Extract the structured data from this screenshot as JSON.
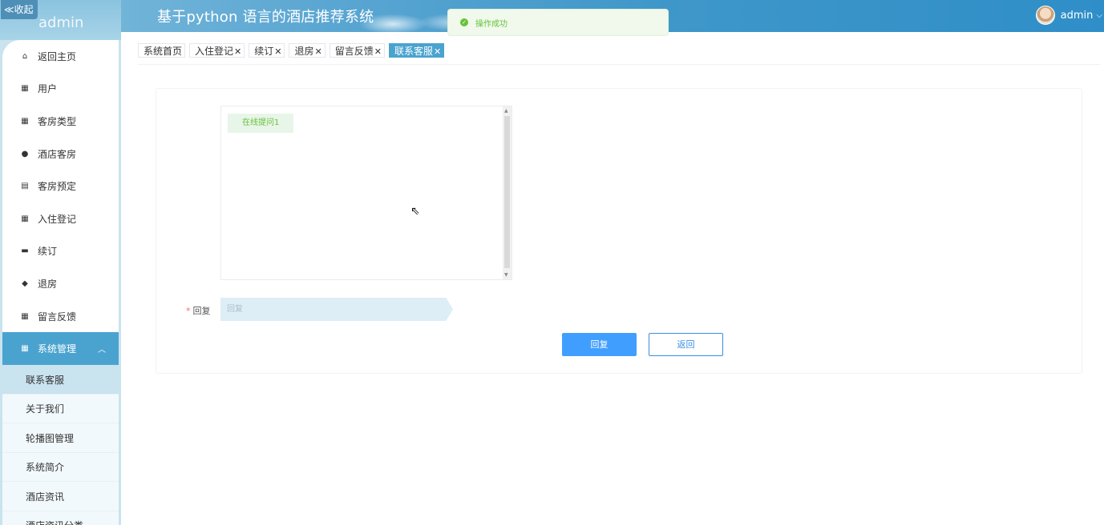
{
  "header": {
    "title": "基于python 语言的酒店推荐系统",
    "collapse_label": "≪收起",
    "user_name": "admin"
  },
  "toast": {
    "text": "操作成功",
    "type": "success"
  },
  "sidebar": {
    "brand_ghost": "admin",
    "items": [
      {
        "label": "返回主页",
        "icon": "home-icon"
      },
      {
        "label": "用户",
        "icon": "grid-icon"
      },
      {
        "label": "客房类型",
        "icon": "grid-icon"
      },
      {
        "label": "酒店客房",
        "icon": "person-icon"
      },
      {
        "label": "客房预定",
        "icon": "clipboard-icon"
      },
      {
        "label": "入住登记",
        "icon": "grid-icon"
      },
      {
        "label": "续订",
        "icon": "briefcase-icon"
      },
      {
        "label": "退房",
        "icon": "pin-icon"
      },
      {
        "label": "留言反馈",
        "icon": "grid-icon"
      }
    ],
    "active_group": {
      "label": "系统管理",
      "icon": "grid-icon",
      "expanded": true
    },
    "sub_items": [
      {
        "label": "联系客服",
        "current": true
      },
      {
        "label": "关于我们"
      },
      {
        "label": "轮播图管理"
      },
      {
        "label": "系统简介"
      },
      {
        "label": "酒店资讯"
      },
      {
        "label": "酒店资讯分类"
      }
    ]
  },
  "tabs": [
    {
      "label": "系统首页",
      "closable": false,
      "active": false
    },
    {
      "label": "入住登记",
      "closable": true,
      "active": false
    },
    {
      "label": "续订",
      "closable": true,
      "active": false
    },
    {
      "label": "退房",
      "closable": true,
      "active": false
    },
    {
      "label": "留言反馈",
      "closable": true,
      "active": false
    },
    {
      "label": "联系客服",
      "closable": true,
      "active": true
    }
  ],
  "chat": {
    "messages": [
      {
        "text": "在线提问1"
      }
    ]
  },
  "form": {
    "reply_label": "回复",
    "required_mark": "*",
    "reply_placeholder": "回复",
    "reply_value": ""
  },
  "buttons": {
    "reply": "回复",
    "back": "返回"
  },
  "colors": {
    "accent": "#4aa3cf",
    "primary": "#409eff",
    "success": "#67c23a",
    "danger": "#f56c6c"
  }
}
